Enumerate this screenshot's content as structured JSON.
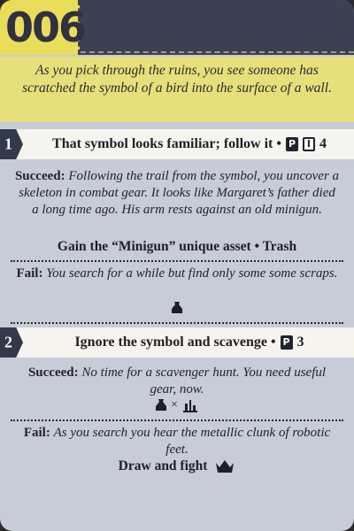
{
  "card": {
    "number": "006",
    "intro": "As you pick through the ruins, you see someone has scratched the symbol of a bird into the surface of a wall."
  },
  "choices": [
    {
      "index": "1",
      "label": "That symbol looks familiar; follow it •",
      "badges": [
        "P",
        "I"
      ],
      "value": "4",
      "succeed_label": "Succeed:",
      "succeed_text": "Following the trail from the symbol, you uncover a skeleton in combat gear. It looks like Margaret’s father died a long time ago. His arm rests against an old minigun.",
      "succeed_reward": "Gain the “Minigun” unique asset • Trash",
      "fail_label": "Fail:",
      "fail_text": "You search for a while but find only some some scraps.",
      "fail_icon": "scrap-bag-icon"
    },
    {
      "index": "2",
      "label": "Ignore the symbol and scavenge •",
      "badges": [
        "P"
      ],
      "value": "3",
      "succeed_label": "Succeed:",
      "succeed_text": "No time for a scavenger hunt. You need useful gear, now.",
      "succeed_icons": [
        "scrap-bag-icon",
        "×",
        "gear-parts-icon"
      ],
      "fail_label": "Fail:",
      "fail_text": "As you search you hear the metallic clunk of robotic feet.",
      "fail_reward": "Draw and fight",
      "fail_icon": "robot-crown-icon"
    }
  ],
  "colors": {
    "header": "#3c4054",
    "number_bg": "#e9dd5a",
    "intro_bg": "#e7e07a",
    "body_bg": "#c7ccd6"
  }
}
